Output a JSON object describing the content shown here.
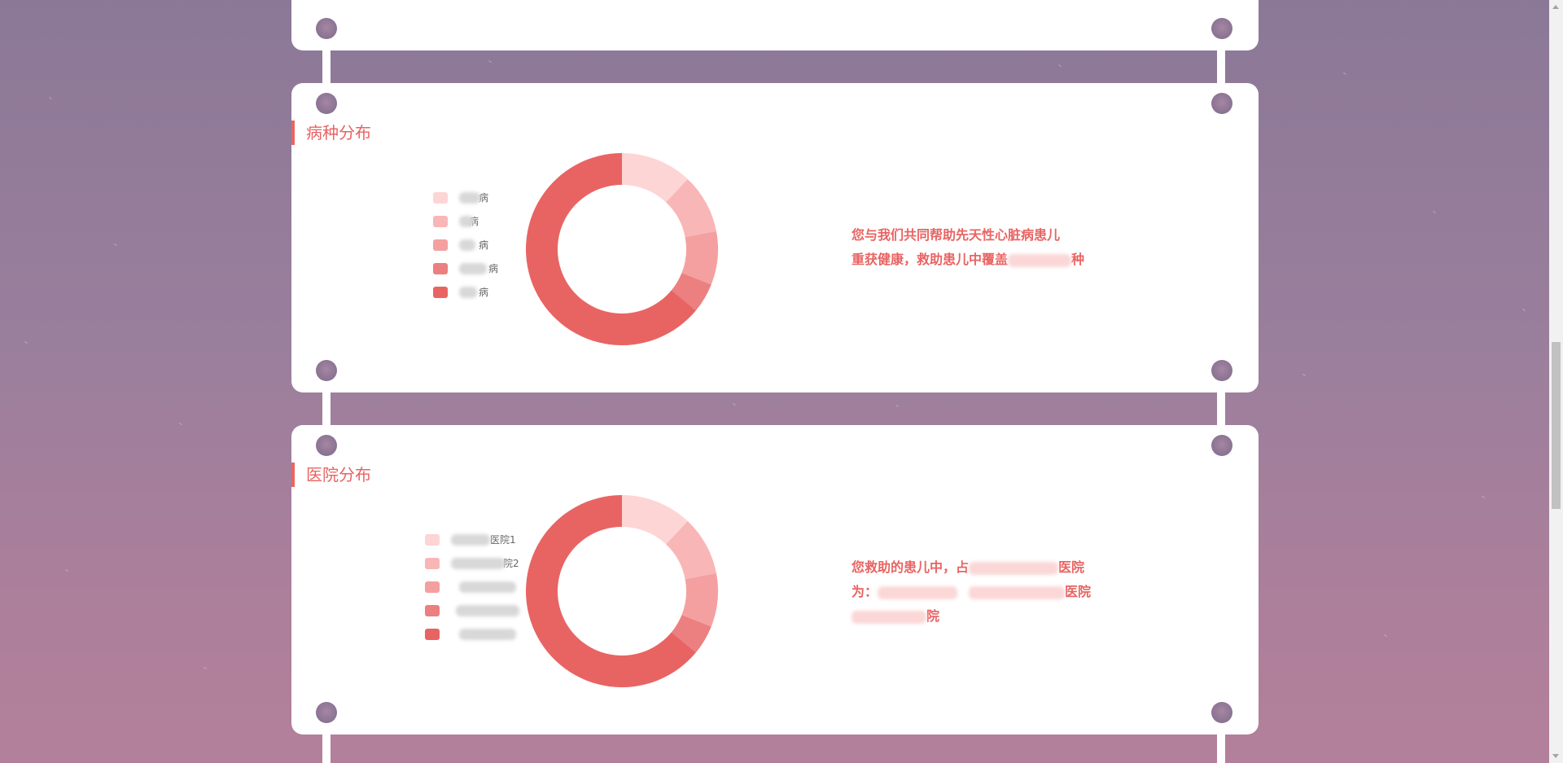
{
  "sections": [
    {
      "title": "病种分布",
      "legend": [
        "病",
        "病",
        "病",
        "病",
        "病"
      ],
      "chart_values": [
        12,
        10,
        9,
        5,
        64
      ],
      "description": {
        "line1": "您与我们共同帮助先天性心脏病患儿",
        "line2": "重获健康，救助患儿中覆盖",
        "line2_end": "种"
      }
    },
    {
      "title": "医院分布",
      "legend": [
        "医院1",
        "院2",
        "",
        "",
        ""
      ],
      "chart_values": [
        12,
        10,
        9,
        5,
        64
      ],
      "description": {
        "line1": "您救助的患儿中，占",
        "line1_end": "医院",
        "line2": "为：",
        "line2_end": "医院",
        "line3_end": "院"
      }
    }
  ],
  "colors": {
    "accent": "#e86463",
    "slices": [
      "#fdd5d5",
      "#f9b6b6",
      "#f4a0a0",
      "#ec7f7f",
      "#e86463"
    ]
  },
  "scroll_icons": [
    "scroll-up-icon",
    "scroll-down-icon"
  ]
}
